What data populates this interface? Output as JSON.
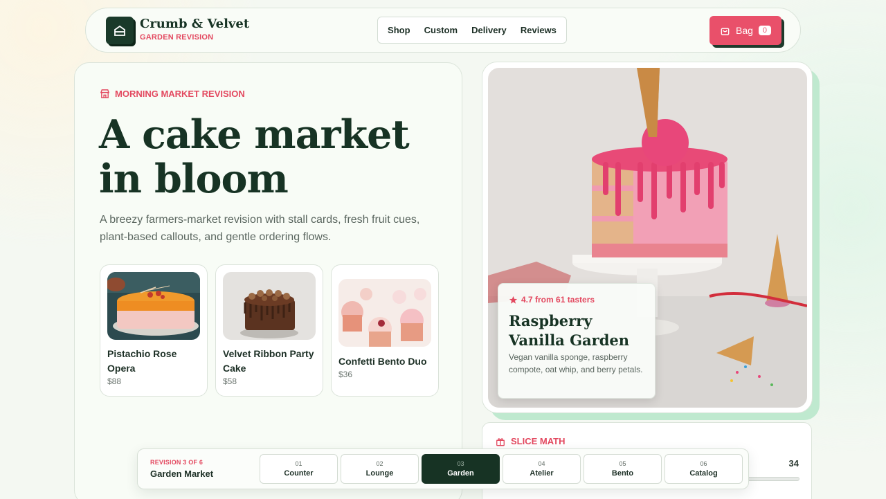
{
  "brand": {
    "name": "Crumb & Velvet",
    "subtitle": "GARDEN REVISION"
  },
  "nav": {
    "items": [
      "Shop",
      "Custom",
      "Delivery",
      "Reviews"
    ]
  },
  "bag": {
    "label": "Bag",
    "count": "0"
  },
  "hero": {
    "eyebrow": "MORNING MARKET REVISION",
    "title_line1": "A cake market",
    "title_line2": "in bloom",
    "lead": "A breezy farmers-market revision with stall cards, fresh fruit cues, plant-based callouts, and gentle ordering flows."
  },
  "products": [
    {
      "name": "Pistachio Rose Opera",
      "price": "$88"
    },
    {
      "name": "Velvet Ribbon Party Cake",
      "price": "$58"
    },
    {
      "name": "Confetti Bento Duo",
      "price": "$36"
    }
  ],
  "feature": {
    "rating": "4.7 from 61 tasters",
    "title": "Raspberry Vanilla Garden",
    "description": "Vegan vanilla sponge, raspberry compote, oat whip, and berry petals."
  },
  "slice_math": {
    "label": "SLICE MATH",
    "value": "34"
  },
  "revision": {
    "counter": "REVISION 3 OF 6",
    "name": "Garden Market",
    "steps": [
      {
        "num": "01",
        "label": "Counter"
      },
      {
        "num": "02",
        "label": "Lounge"
      },
      {
        "num": "03",
        "label": "Garden"
      },
      {
        "num": "04",
        "label": "Atelier"
      },
      {
        "num": "05",
        "label": "Bento"
      },
      {
        "num": "06",
        "label": "Catalog"
      }
    ],
    "active_index": 2
  },
  "colors": {
    "accent": "#e9506a",
    "ink": "#173324",
    "mint": "#bfe9cf",
    "background": "#f4f8f2"
  }
}
